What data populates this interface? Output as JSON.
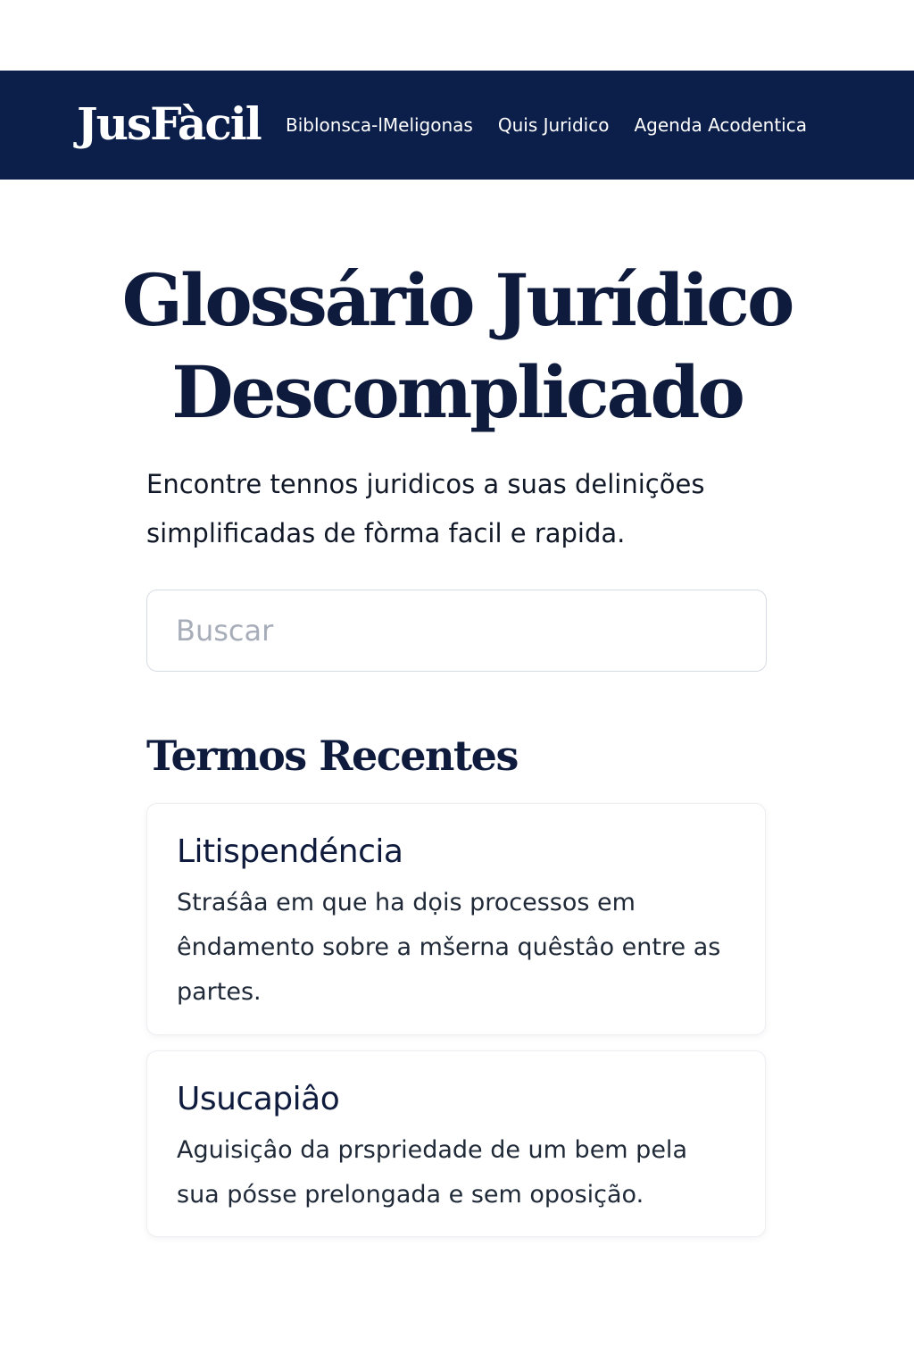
{
  "header": {
    "logo": "JusFàcil",
    "nav": [
      {
        "label": "Biblonsca-lMeligonas"
      },
      {
        "label": "Quis Juridico"
      },
      {
        "label": "Agenda Acodentica"
      }
    ]
  },
  "hero": {
    "title_line1": "Glossário Jurídico",
    "title_line2": "Descomplicado",
    "subtitle_line1": "Encontre tennos juridicos a suas delinições",
    "subtitle_line2": "simplificadas de fòrma facil e rapida."
  },
  "search": {
    "placeholder": "Buscar",
    "value": ""
  },
  "recent": {
    "title": "Termos Recentes",
    "items": [
      {
        "term": "Litispendéncia",
        "desc_lines": [
          "Straśâa em que ha dọis processos em",
          "êndamento sobre a mšerna quêstâo entre as",
          "partes."
        ]
      },
      {
        "term": "Usucapiâo",
        "desc_lines": [
          "Aguisiçâo da prspriedade de um bem pela",
          "sua pósse prelongada e sem oposição."
        ]
      }
    ]
  },
  "colors": {
    "header_bg": "#0c1f4a",
    "text_primary": "#0f1b3d",
    "border": "#d7dbe3",
    "placeholder": "#a7adb9"
  }
}
